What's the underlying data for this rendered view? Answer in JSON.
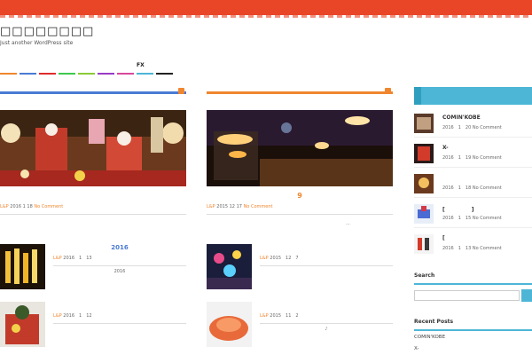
{
  "site": {
    "title": "□□□□□□□□",
    "description": "Just another WordPress site"
  },
  "nav": {
    "label": "FX",
    "colors": [
      "#f0862e",
      "#4a7bd4",
      "#e02b2b",
      "#3cc94d",
      "#8acb36",
      "#9b3bc6",
      "#d8489b",
      "#4db6d6",
      "#222222"
    ]
  },
  "posts": [
    {
      "bar_color": "#4a7bd4",
      "title": "",
      "category": "L&P",
      "date_y": "2016",
      "date_m": "1",
      "date_d": "18",
      "comments": "No Comment",
      "more": ""
    },
    {
      "bar_color": "#f0862e",
      "title": "9",
      "category": "L&P",
      "date_y": "2015",
      "date_m": "12",
      "date_d": "17",
      "comments": "No Comment",
      "more": "..."
    }
  ],
  "small_posts": [
    {
      "title": "2016",
      "category": "L&P",
      "date": "2016　1　13",
      "excerpt": "2016"
    },
    {
      "title": "",
      "category": "L&P",
      "date": "2015　12　7",
      "excerpt": ""
    },
    {
      "title": "",
      "category": "L&P",
      "date": "2016　1　12",
      "excerpt": ""
    },
    {
      "title": "",
      "category": "L&P",
      "date": "2015　11　2",
      "excerpt": "♪"
    }
  ],
  "sidebar": {
    "items": [
      {
        "name": "COMIN'KOBE",
        "date": "2016　1　20",
        "comments": "No Comment"
      },
      {
        "name": "X-",
        "date": "2016　1　19",
        "comments": "No Comment"
      },
      {
        "name": "",
        "date": "2016　1　18",
        "comments": "No Comment"
      },
      {
        "name": "[　　　　　]",
        "date": "2016　1　15",
        "comments": "No Comment"
      },
      {
        "name": "[",
        "date": "2016　1　13",
        "comments": "No Comment"
      }
    ],
    "search_heading": "Search",
    "recent_heading": "Recent Posts",
    "recent": [
      "COMIN'KOBE",
      "X-"
    ]
  }
}
